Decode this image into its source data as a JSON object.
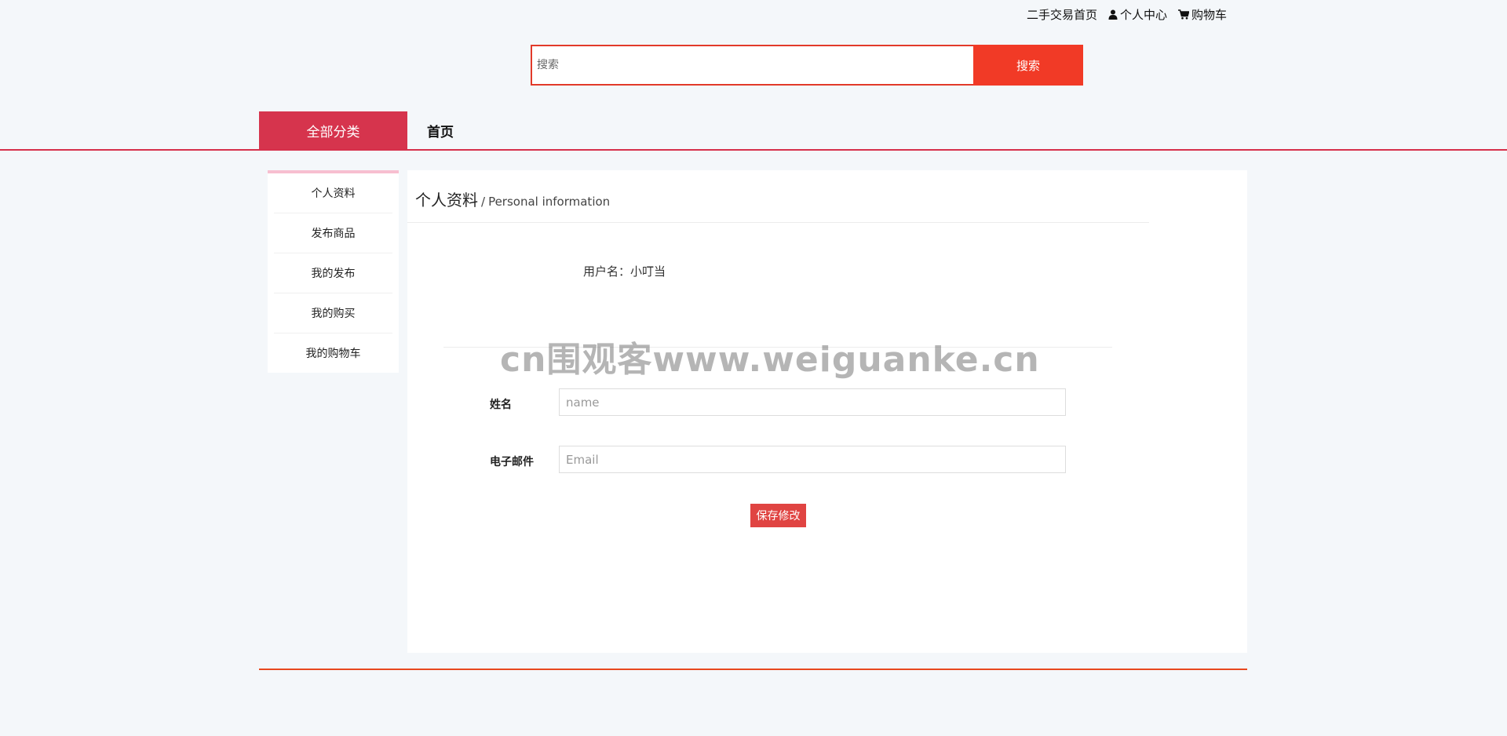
{
  "header": {
    "links": [
      {
        "label": "二手交易首页",
        "icon": ""
      },
      {
        "label": "个人中心",
        "icon": "user-icon"
      },
      {
        "label": "购物车",
        "icon": "cart-icon"
      }
    ]
  },
  "search": {
    "placeholder": "搜索",
    "button_label": "搜索"
  },
  "nav": {
    "all_categories": "全部分类",
    "home": "首页"
  },
  "sidebar": {
    "items": [
      {
        "label": "个人资料"
      },
      {
        "label": "发布商品"
      },
      {
        "label": "我的发布"
      },
      {
        "label": "我的购买"
      },
      {
        "label": "我的购物车"
      }
    ]
  },
  "panel": {
    "title_cn": "个人资料",
    "title_sep": "/",
    "title_en": "Personal information",
    "username_label": "用户名：",
    "username_value": "小叮当",
    "watermark": "cn围观客www.weiguanke.cn",
    "form": {
      "name_label": "姓名",
      "name_placeholder": "name",
      "email_label": "电子邮件",
      "email_placeholder": "Email",
      "save_label": "保存修改"
    }
  },
  "colors": {
    "accent_red": "#f13a26",
    "nav_red": "#d6344d",
    "sidebar_top_pink": "#f7bfd0",
    "save_red": "#e04442",
    "page_bg": "#f4f7fa"
  }
}
